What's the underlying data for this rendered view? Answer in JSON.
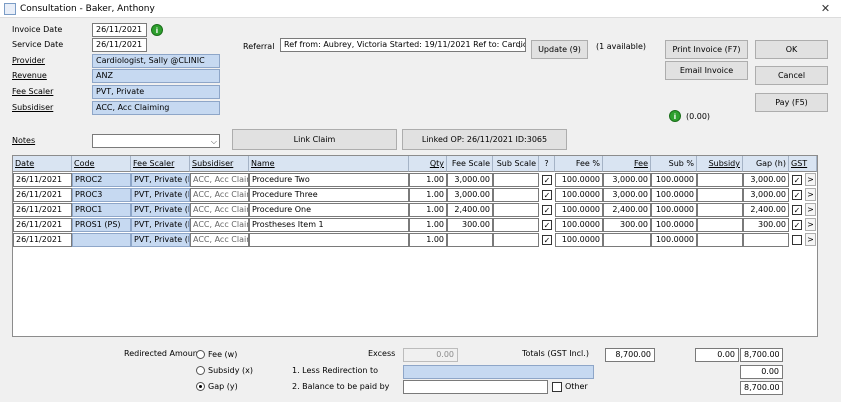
{
  "window": {
    "title": "Consultation - Baker, Anthony",
    "close_glyph": "✕"
  },
  "form": {
    "invoice_date_label": "Invoice Date",
    "invoice_date": "26/11/2021",
    "service_date_label": "Service Date",
    "service_date": "26/11/2021",
    "provider_label": "Provider",
    "provider": "Cardiologist, Sally @CLINIC",
    "revenue_label": "Revenue",
    "revenue": "ANZ",
    "fee_scaler_label": "Fee Scaler",
    "fee_scaler": "PVT, Private",
    "subsidiser_label": "Subsidiser",
    "subsidiser": "ACC, Acc Claiming",
    "referral_label": "Referral",
    "referral": "Ref from: Aubrey, Victoria Started: 19/11/2021 Ref to: Cardiologist,",
    "update_label": "Update (9)",
    "available": "(1 available)",
    "notes_label": "Notes",
    "notes": "",
    "link_claim_label": "Link Claim",
    "linked_op": "Linked OP: 26/11/2021 ID:3065",
    "info_icon": "i",
    "balance_info": "(0.00)"
  },
  "buttons": {
    "print_invoice": "Print Invoice (F7)",
    "email_invoice": "Email Invoice",
    "ok": "OK",
    "cancel": "Cancel",
    "pay": "Pay (F5)"
  },
  "grid": {
    "headers": [
      "Date",
      "Code",
      "Fee Scaler",
      "Subsidiser",
      "Name",
      "Qty",
      "Fee Scale",
      "Sub Scale",
      "?",
      "Fee %",
      "Fee",
      "Sub %",
      "Subsidy",
      "Gap (h)",
      "GST"
    ],
    "rows": [
      {
        "date": "26/11/2021",
        "code": "PROC2",
        "scaler": "PVT, Private (Fee",
        "subsidiser": "ACC, Acc Claimin",
        "name": "Procedure Two",
        "qty": "1.00",
        "fee_scale": "3,000.00",
        "sub_scale": "",
        "check": "✓",
        "fee_pct": "100.0000",
        "fee": "3,000.00",
        "sub_pct": "100.0000",
        "subsidy": "",
        "gap": "3,000.00",
        "gst": "✓"
      },
      {
        "date": "26/11/2021",
        "code": "PROC3",
        "scaler": "PVT, Private (Fee",
        "subsidiser": "ACC, Acc Claimin",
        "name": "Procedure Three",
        "qty": "1.00",
        "fee_scale": "3,000.00",
        "sub_scale": "",
        "check": "✓",
        "fee_pct": "100.0000",
        "fee": "3,000.00",
        "sub_pct": "100.0000",
        "subsidy": "",
        "gap": "3,000.00",
        "gst": "✓"
      },
      {
        "date": "26/11/2021",
        "code": "PROC1",
        "scaler": "PVT, Private (Fee",
        "subsidiser": "ACC, Acc Claimin",
        "name": "Procedure One",
        "qty": "1.00",
        "fee_scale": "2,400.00",
        "sub_scale": "",
        "check": "✓",
        "fee_pct": "100.0000",
        "fee": "2,400.00",
        "sub_pct": "100.0000",
        "subsidy": "",
        "gap": "2,400.00",
        "gst": "✓"
      },
      {
        "date": "26/11/2021",
        "code": "PROS1 (PS)",
        "scaler": "PVT, Private (Fee",
        "subsidiser": "ACC, Acc Claimin",
        "name": "Prostheses Item 1",
        "qty": "1.00",
        "fee_scale": "300.00",
        "sub_scale": "",
        "check": "✓",
        "fee_pct": "100.0000",
        "fee": "300.00",
        "sub_pct": "100.0000",
        "subsidy": "",
        "gap": "300.00",
        "gst": "✓"
      },
      {
        "date": "26/11/2021",
        "code": "",
        "scaler": "PVT, Private (Fee",
        "subsidiser": "ACC, Acc Claimin",
        "name": "",
        "qty": "1.00",
        "fee_scale": "",
        "sub_scale": "",
        "check": "✓",
        "fee_pct": "100.0000",
        "fee": "",
        "sub_pct": "100.0000",
        "subsidy": "",
        "gap": "",
        "gst": ""
      }
    ],
    "row_button": ">"
  },
  "footer": {
    "redirected_amount_label": "Redirected Amount",
    "radio_fee": "Fee (w)",
    "radio_subsidy": "Subsidy (x)",
    "radio_gap": "Gap (y)",
    "excess_label": "Excess",
    "excess_value": "0.00",
    "totals_label": "Totals (GST Incl.)",
    "totals_fee": "8,700.00",
    "totals_subsidy": "0.00",
    "totals_gap": "8,700.00",
    "less_redirection_label": "1. Less Redirection to",
    "less_redirection_value": "0.00",
    "balance_label": "2. Balance to be paid by",
    "other_label": "Other",
    "balance_value": "8,700.00"
  }
}
